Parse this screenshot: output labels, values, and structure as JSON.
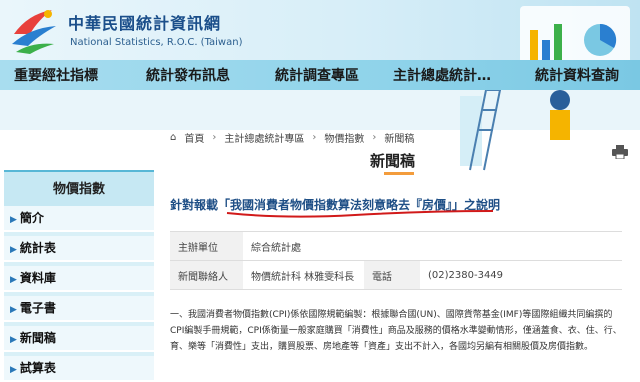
{
  "site": {
    "title": "中華民國統計資訊網",
    "subtitle": "National Statistics, R.O.C. (Taiwan)"
  },
  "nav": [
    "重要經社指標",
    "統計發布訊息",
    "統計調查專區",
    "主計總處統計…",
    "統計資料查詢"
  ],
  "breadcrumb": [
    "首頁",
    "主計總處統計專區",
    "物價指數",
    "新聞稿"
  ],
  "page_title": "新聞稿",
  "sidebar": {
    "title": "物價指數",
    "items": [
      "簡介",
      "統計表",
      "資料庫",
      "電子書",
      "新聞稿",
      "試算表"
    ]
  },
  "headline": "針對報載「我國消費者物價指數算法刻意略去『房價』」之說明",
  "info": {
    "unit_label": "主辦單位",
    "unit_value": "綜合統計處",
    "contact_label": "新聞聯絡人",
    "contact_value": "物價統計科 林雅雯科長",
    "phone_label": "電話",
    "phone_value": "(02)2380-3449"
  },
  "paragraph": "一、我國消費者物價指數(CPI)係依國際規範編製：根據聯合國(UN)、國際貨幣基金(IMF)等國際組織共同編撰的CPI編製手冊規範，CPI係衡量一般家庭購買「消費性」商品及服務的價格水準變動情形，僅涵蓋食、衣、住、行、育、樂等「消費性」支出，購買股票、房地產等「資產」支出不計入，各國均另編有相關股價及房價指數。",
  "colors": {
    "brand": "#1a4e8a",
    "nav_bg": "#8fd3ea",
    "accent": "#f39c3c",
    "underline": "#d11a1a"
  }
}
